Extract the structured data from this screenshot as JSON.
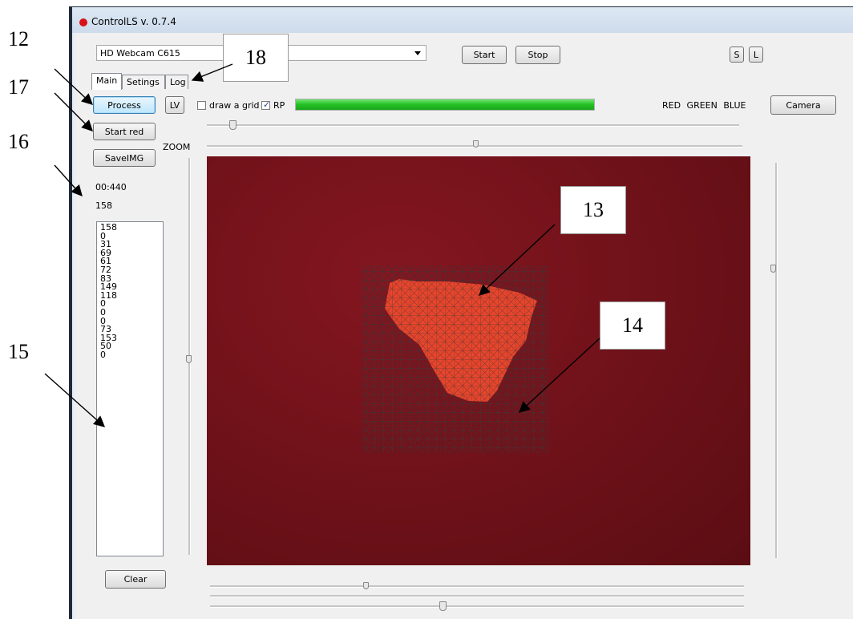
{
  "window": {
    "title": "ControlLS v. 0.7.4"
  },
  "toolbar": {
    "camera_select": "HD Webcam C615",
    "start_label": "Start",
    "stop_label": "Stop",
    "s_label": "S",
    "l_label": "L"
  },
  "tabs": [
    {
      "label": "Main",
      "active": true
    },
    {
      "label": "Setings",
      "active": false
    },
    {
      "label": "Log",
      "active": false
    }
  ],
  "main": {
    "process_label": "Process",
    "lv_label": "LV",
    "draw_grid_label": "draw a grid",
    "draw_grid_checked": false,
    "rp_label": "RP",
    "rp_checked": true,
    "progress_percent": 100,
    "channels": "RED GREEN BLUE",
    "camera_label": "Camera",
    "start_red_label": "Start red",
    "saveimg_label": "SaveIMG",
    "zoom_label": "ZOOM",
    "timer": "00:440",
    "count": "158",
    "log_values": [
      "158",
      "0",
      "31",
      "69",
      "61",
      "72",
      "83",
      "149",
      "118",
      "0",
      "0",
      "0",
      "73",
      "153",
      "50",
      "0"
    ],
    "clear_label": "Clear"
  },
  "callouts": {
    "c12": "12",
    "c17": "17",
    "c16": "16",
    "c15": "15",
    "c18": "18",
    "c13": "13",
    "c14": "14"
  },
  "colors": {
    "accent": "#3c7fb1",
    "record_dot": "#d8101a",
    "progress_fill": "#25c025",
    "video_bg": "#6e1118",
    "blob": "#f04a2e"
  }
}
